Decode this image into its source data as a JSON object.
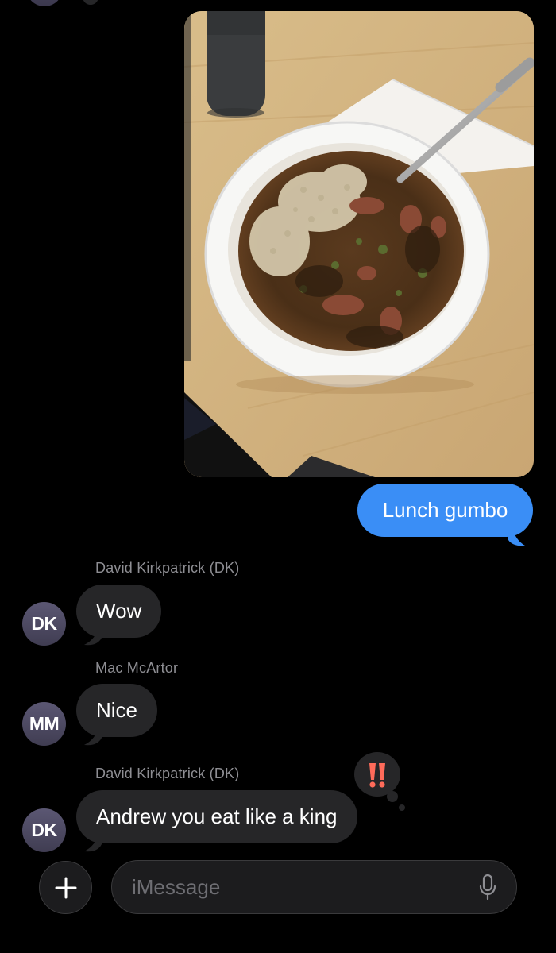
{
  "messages": {
    "outgoing_text": "Lunch gumbo",
    "thread": [
      {
        "sender": "David Kirkpatrick (DK)",
        "initials": "DK",
        "text": "Wow"
      },
      {
        "sender": "Mac McArtor",
        "initials": "MM",
        "text": "Nice"
      },
      {
        "sender": "David Kirkpatrick (DK)",
        "initials": "DK",
        "text": "Andrew you eat like a king",
        "tapback": "‼️"
      }
    ]
  },
  "composer": {
    "placeholder": "iMessage",
    "icons": {
      "plus": "plus-icon",
      "mic": "microphone-icon"
    }
  },
  "colors": {
    "outgoing_bubble": "#3a8ef6",
    "incoming_bubble": "#262628",
    "background": "#000000"
  }
}
